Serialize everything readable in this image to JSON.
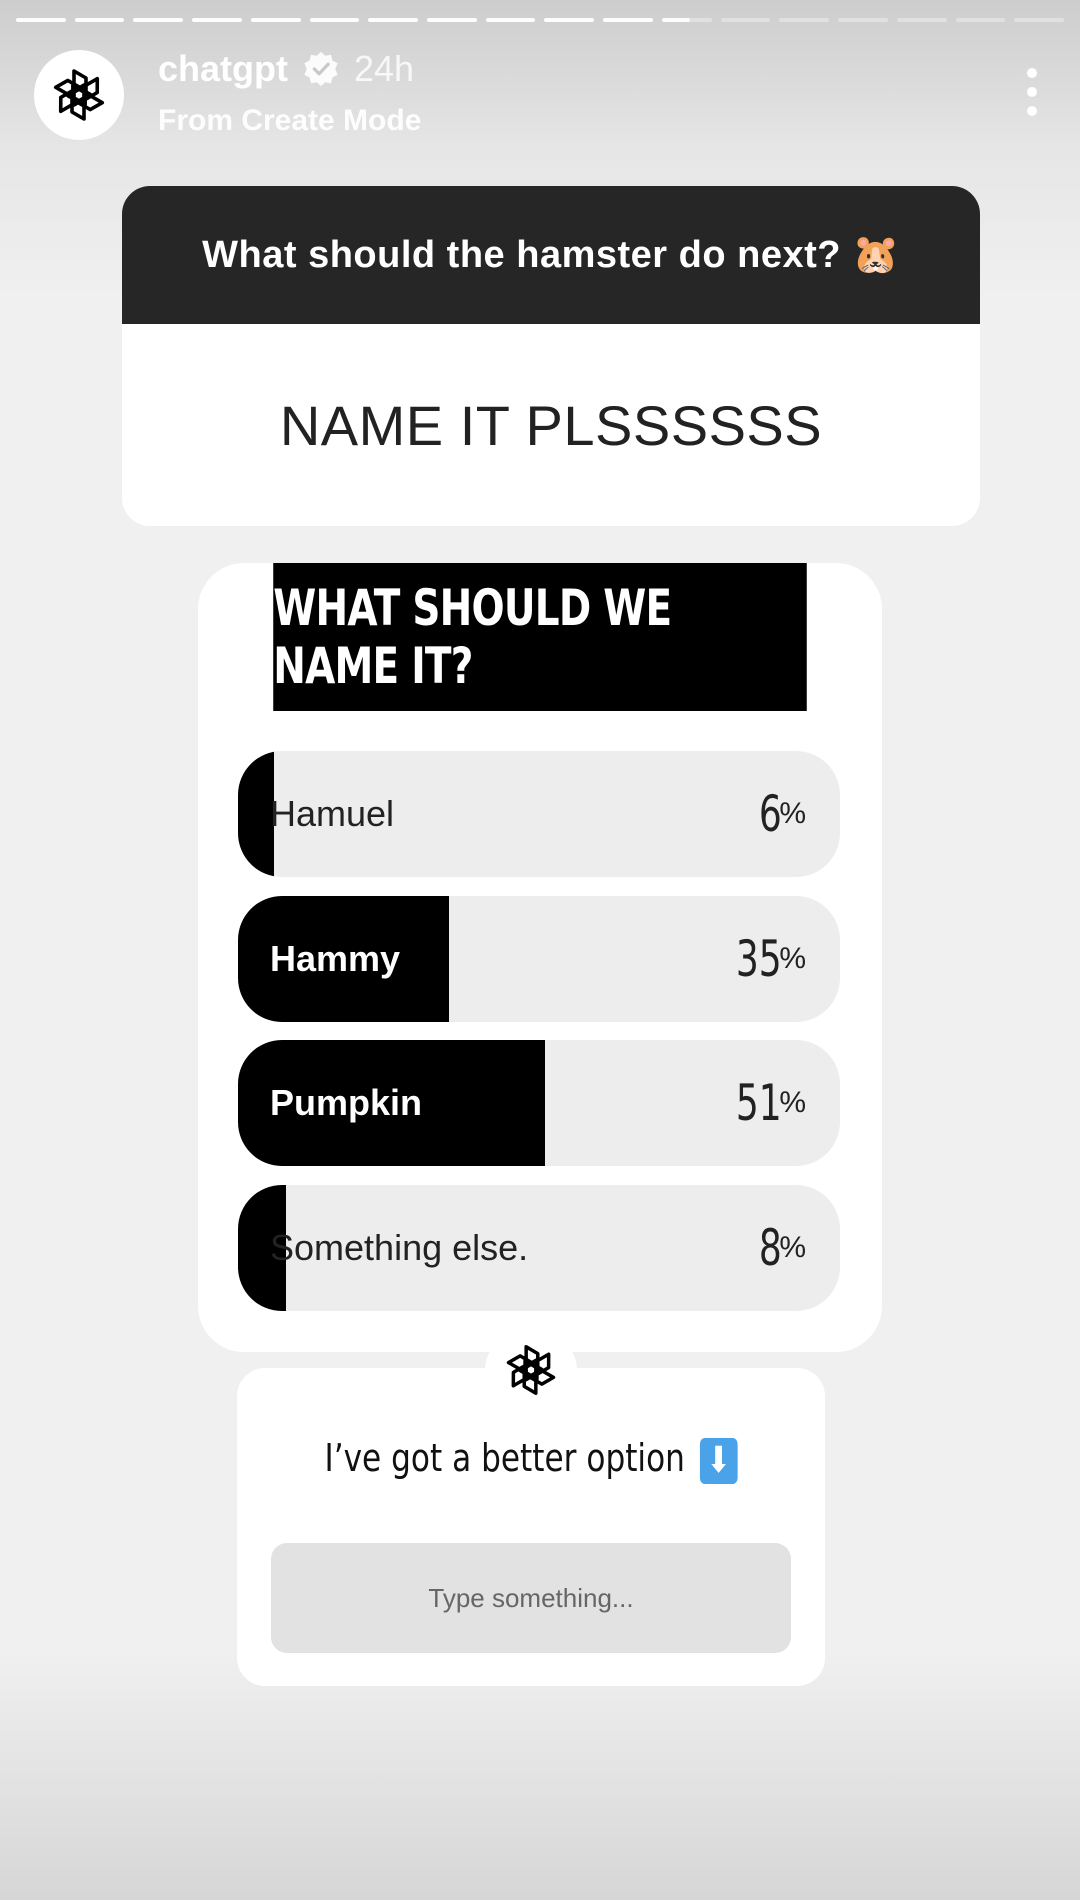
{
  "story": {
    "segments_total": 18,
    "segments_viewed": 11,
    "current_segment_progress": 0.55
  },
  "header": {
    "username": "chatgpt",
    "time": "24h",
    "subtitle": "From Create Mode"
  },
  "question": {
    "prompt": "What should the hamster do next? 🐹",
    "answer": "NAME IT PLSSSSSS"
  },
  "poll": {
    "title": "WHAT SHOULD WE NAME IT?",
    "options": [
      {
        "label": "Hamuel",
        "percent": "6",
        "unit": "%"
      },
      {
        "label": "Hammy",
        "percent": "35",
        "unit": "%"
      },
      {
        "label": "Pumpkin",
        "percent": "51",
        "unit": "%"
      },
      {
        "label": "Something else.",
        "percent": "8",
        "unit": "%"
      }
    ]
  },
  "reply": {
    "title": "I’ve got a better option",
    "arrow_glyph": "⬇",
    "placeholder": "Type something..."
  },
  "colors": {
    "poll_fill": "#000000",
    "option_bg": "#ededed",
    "question_header": "#262626"
  }
}
